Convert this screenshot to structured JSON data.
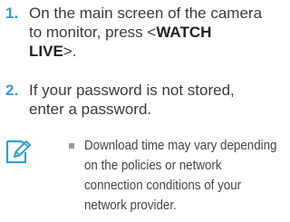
{
  "accent_color": "#2f9fd6",
  "steps": [
    {
      "number": "1.",
      "line1": "On the main screen of the camera",
      "line2_prefix": "to monitor, press <",
      "line2_bold": "WATCH",
      "line3_bold": "LIVE",
      "line3_suffix": ">."
    },
    {
      "number": "2.",
      "line1": "If your password is not stored,",
      "line2": "enter a password."
    }
  ],
  "note": {
    "icon": "note-pencil-icon",
    "lines": [
      "Download time may vary depending",
      "on the policies or network",
      "connection conditions of your",
      "network provider."
    ]
  }
}
